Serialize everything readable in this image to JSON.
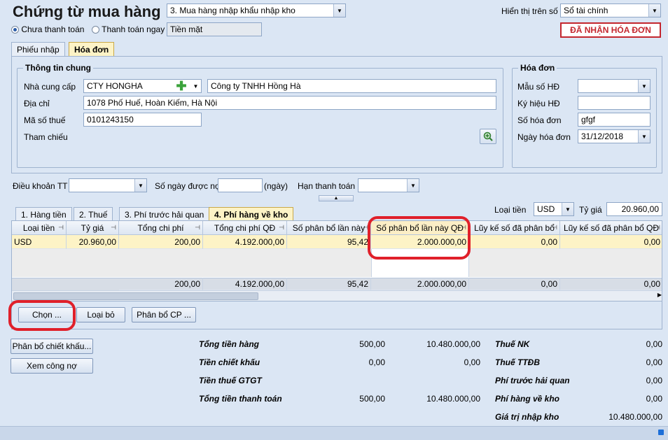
{
  "header": {
    "title": "Chứng từ mua hàng",
    "voucher_type": "3. Mua hàng nhập khẩu nhập kho",
    "display_label": "Hiển thị trên số",
    "display_value": "Sổ tài chính",
    "stamp": "ĐÃ NHẬN HÓA ĐƠN"
  },
  "payment": {
    "unpaid_label": "Chưa thanh toán",
    "paid_label": "Thanh toán ngay",
    "method": "Tiền mặt"
  },
  "tabs": [
    "Phiếu nhập",
    "Hóa đơn"
  ],
  "general": {
    "title": "Thông tin chung",
    "supplier_label": "Nhà cung cấp",
    "supplier_code": "CTY HONGHA",
    "supplier_name": "Công ty TNHH Hồng Hà",
    "address_label": "Địa chỉ",
    "address": "1078 Phố Huế, Hoàn Kiếm, Hà Nội",
    "tax_label": "Mã số thuế",
    "tax_code": "0101243150",
    "ref_label": "Tham chiếu"
  },
  "invoice": {
    "title": "Hóa đơn",
    "form_label": "Mẫu số HĐ",
    "form_value": "",
    "symbol_label": "Ký hiệu HĐ",
    "symbol_value": "",
    "number_label": "Số hóa đơn",
    "number_value": "gfgf",
    "date_label": "Ngày hóa đơn",
    "date_value": "31/12/2018"
  },
  "terms": {
    "terms_label": "Điều khoản TT",
    "days_label": "Số ngày được nợ",
    "days_unit": "(ngày)",
    "due_label": "Hạn thanh toán"
  },
  "detail_tabs": [
    "1. Hàng tiền",
    "2. Thuế",
    "3. Phí trước hải quan",
    "4. Phí hàng về kho"
  ],
  "currency": {
    "label": "Loại tiền",
    "value": "USD",
    "rate_label": "Tỷ giá",
    "rate_value": "20.960,00"
  },
  "grid": {
    "columns": [
      "Loại tiền",
      "Tỷ giá",
      "Tổng chi phí",
      "Tổng chi phí QĐ",
      "Số phân bổ lần này",
      "Số phân bổ lần này QĐ",
      "Lũy kế số đã phân bổ",
      "Lũy kế số đã phân bổ QĐ"
    ],
    "row": [
      "USD",
      "20.960,00",
      "200,00",
      "4.192.000,00",
      "95,42",
      "2.000.000,00",
      "0,00",
      "0,00"
    ],
    "footer": [
      "",
      "",
      "200,00",
      "4.192.000,00",
      "95,42",
      "2.000.000,00",
      "0,00",
      "0,00"
    ]
  },
  "buttons": {
    "choose": "Chọn ...",
    "remove": "Loại bỏ",
    "allocate": "Phân bổ CP ...",
    "discount": "Phân bổ chiết khấu...",
    "debt": "Xem công nợ"
  },
  "totals": {
    "goods_label": "Tổng tiền hàng",
    "goods_fc": "500,00",
    "goods": "10.480.000,00",
    "discount_label": "Tiền chiết khấu",
    "discount_fc": "0,00",
    "discount": "0,00",
    "vat_label": "Tiền thuế GTGT",
    "pay_label": "Tổng tiền thanh toán",
    "pay_fc": "500,00",
    "pay": "10.480.000,00",
    "import_tax_label": "Thuế NK",
    "import_tax": "0,00",
    "special_tax_label": "Thuế TTĐB",
    "special_tax": "0,00",
    "customs_fee_label": "Phí trước hải quan",
    "customs_fee": "0,00",
    "warehouse_fee_label": "Phí hàng về kho",
    "warehouse_fee": "0,00",
    "import_value_label": "Giá trị nhập kho",
    "import_value": "10.480.000,00"
  }
}
